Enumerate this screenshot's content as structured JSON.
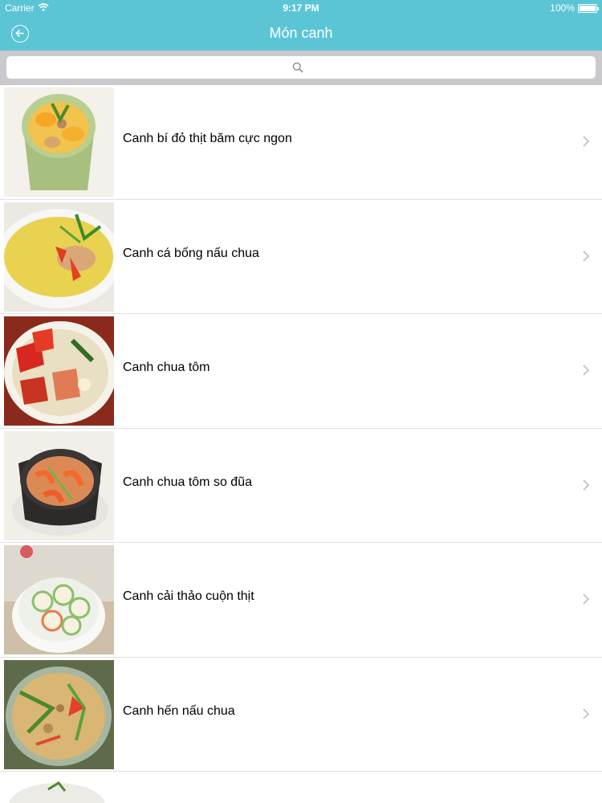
{
  "status_bar": {
    "carrier": "Carrier",
    "time": "9:17 PM",
    "battery": "100%"
  },
  "nav": {
    "title": "Món canh"
  },
  "search": {
    "placeholder": ""
  },
  "items": [
    {
      "label": "Canh bí đỏ thịt băm cực ngon"
    },
    {
      "label": "Canh cá bống nấu chua"
    },
    {
      "label": "Canh chua tôm"
    },
    {
      "label": "Canh chua tôm so đũa"
    },
    {
      "label": "Canh cải thảo cuộn thịt"
    },
    {
      "label": "Canh hến nấu chua"
    }
  ],
  "colors": {
    "nav": "#5bc5d6",
    "search_bg": "#c9c9ce",
    "separator": "#e0e0e0",
    "chevron": "#c7c7cc"
  }
}
